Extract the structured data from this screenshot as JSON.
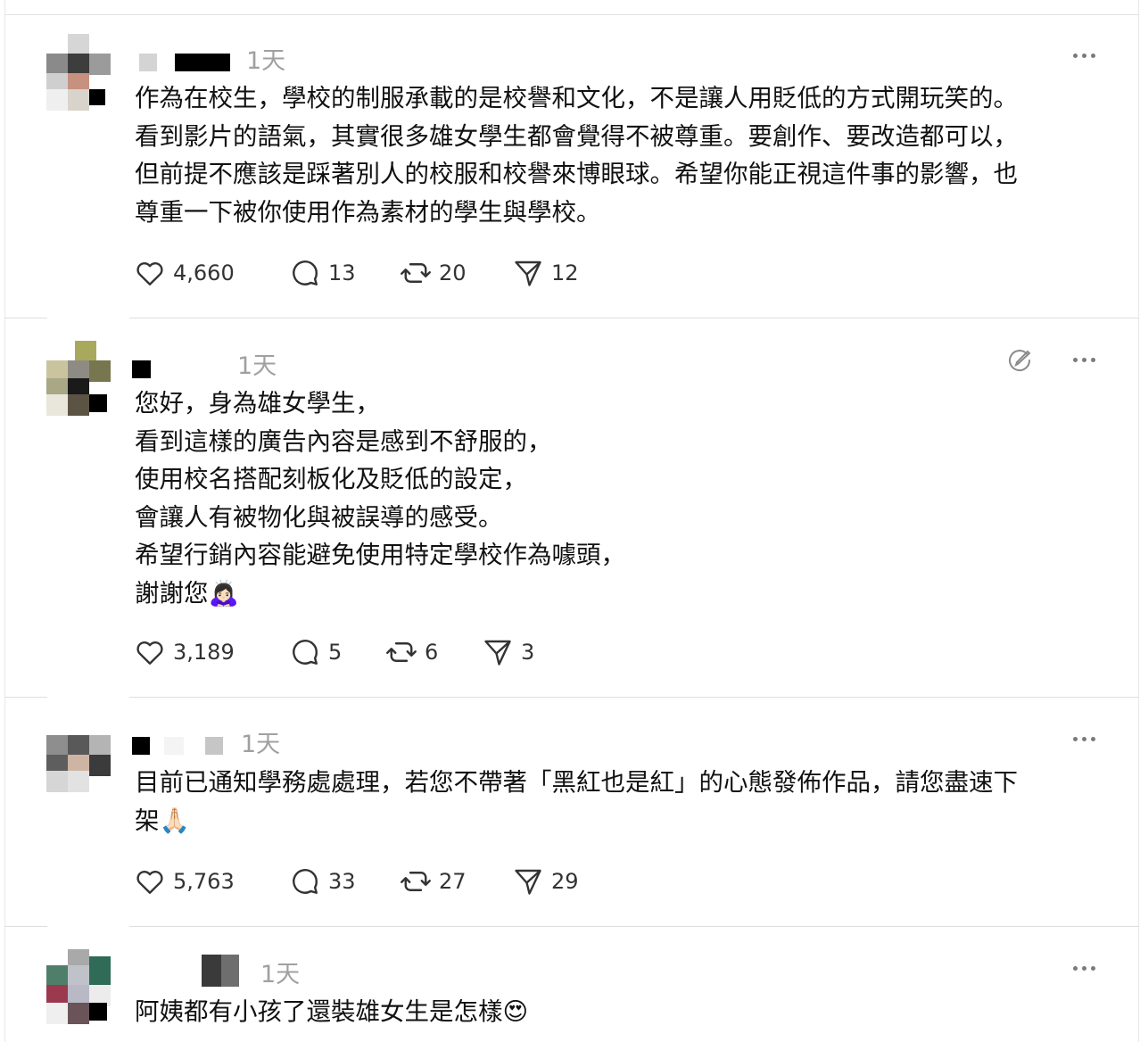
{
  "posts": [
    {
      "time": "1天",
      "lines": [
        "作為在校生，學校的制服承載的是校譽和文化，不是讓人用貶低的方式開玩笑的。",
        "看到影片的語氣，其實很多雄女學生都會覺得不被尊重。要創作、要改造都可以，",
        "但前提不應該是踩著別人的校服和校譽來博眼球。希望你能正視這件事的影響，也",
        "尊重一下被你使用作為素材的學生與學校。"
      ],
      "likes": "4,660",
      "replies": "13",
      "reposts": "20",
      "shares": "12"
    },
    {
      "time": "1天",
      "lines": [
        "您好，身為雄女學生，",
        "看到這樣的廣告內容是感到不舒服的，",
        "使用校名搭配刻板化及貶低的設定，",
        "會讓人有被物化與被誤導的感受。",
        "希望行銷內容能避免使用特定學校作為噱頭，",
        "謝謝您🙇🏻‍♀️"
      ],
      "likes": "3,189",
      "replies": "5",
      "reposts": "6",
      "shares": "3"
    },
    {
      "time": "1天",
      "lines": [
        "目前已通知學務處處理，若您不帶著「黑紅也是紅」的心態發佈作品，請您盡速下",
        "架🙏🏻"
      ],
      "likes": "5,763",
      "replies": "33",
      "reposts": "27",
      "shares": "29"
    },
    {
      "time": "1天",
      "lines": [
        "阿姨都有小孩了還裝雄女生是怎樣😍"
      ]
    }
  ],
  "icons": {
    "like": "heart-icon",
    "reply": "comment-icon",
    "repost": "repost-icon",
    "share": "send-icon",
    "more": "more-icon",
    "edit": "edit-icon"
  }
}
